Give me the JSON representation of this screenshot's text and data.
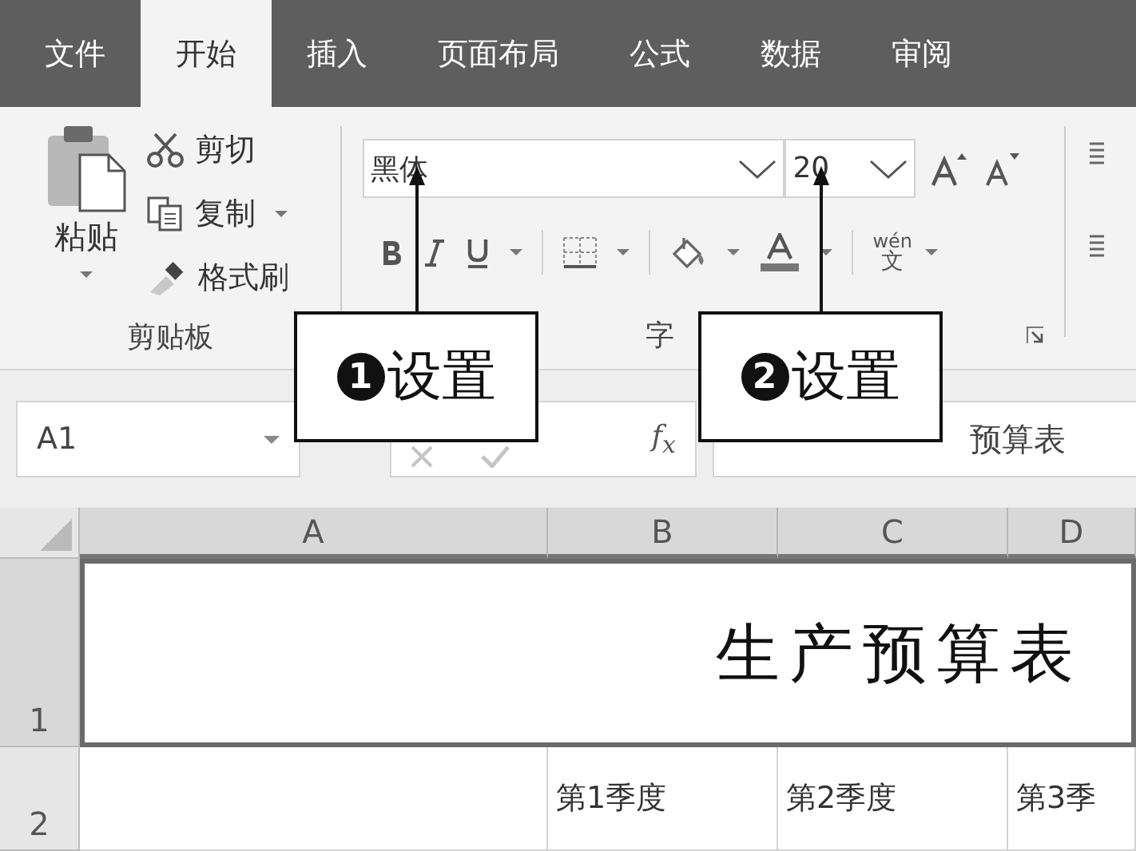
{
  "tabs": [
    {
      "label": "文件",
      "selected": false
    },
    {
      "label": "开始",
      "selected": true
    },
    {
      "label": "插入",
      "selected": false
    },
    {
      "label": "页面布局",
      "selected": false
    },
    {
      "label": "公式",
      "selected": false
    },
    {
      "label": "数据",
      "selected": false
    },
    {
      "label": "审阅",
      "selected": false
    }
  ],
  "clipboard": {
    "paste": "粘贴",
    "items": [
      {
        "kind": "cut",
        "label": "剪切"
      },
      {
        "kind": "copy",
        "label": "复制"
      },
      {
        "kind": "painter",
        "label": "格式刷"
      }
    ],
    "group_label": "剪贴板"
  },
  "font": {
    "font_name": "黑体",
    "font_size": "20",
    "wen": "wén",
    "wen_char": "文",
    "group_label": "字"
  },
  "formula_bar": {
    "name_box": "A1",
    "fx": "f$_{x}$",
    "formula": "预算表"
  },
  "columns": [
    "A",
    "B",
    "C",
    "D"
  ],
  "rows": [
    {
      "number": "1",
      "title": "生产预算表"
    },
    {
      "number": "2",
      "cells": [
        "",
        "第1季度",
        "第2季度",
        "第3季"
      ]
    }
  ],
  "callouts": [
    {
      "number": "1",
      "text": "设置"
    },
    {
      "number": "2",
      "text": "设置"
    }
  ]
}
